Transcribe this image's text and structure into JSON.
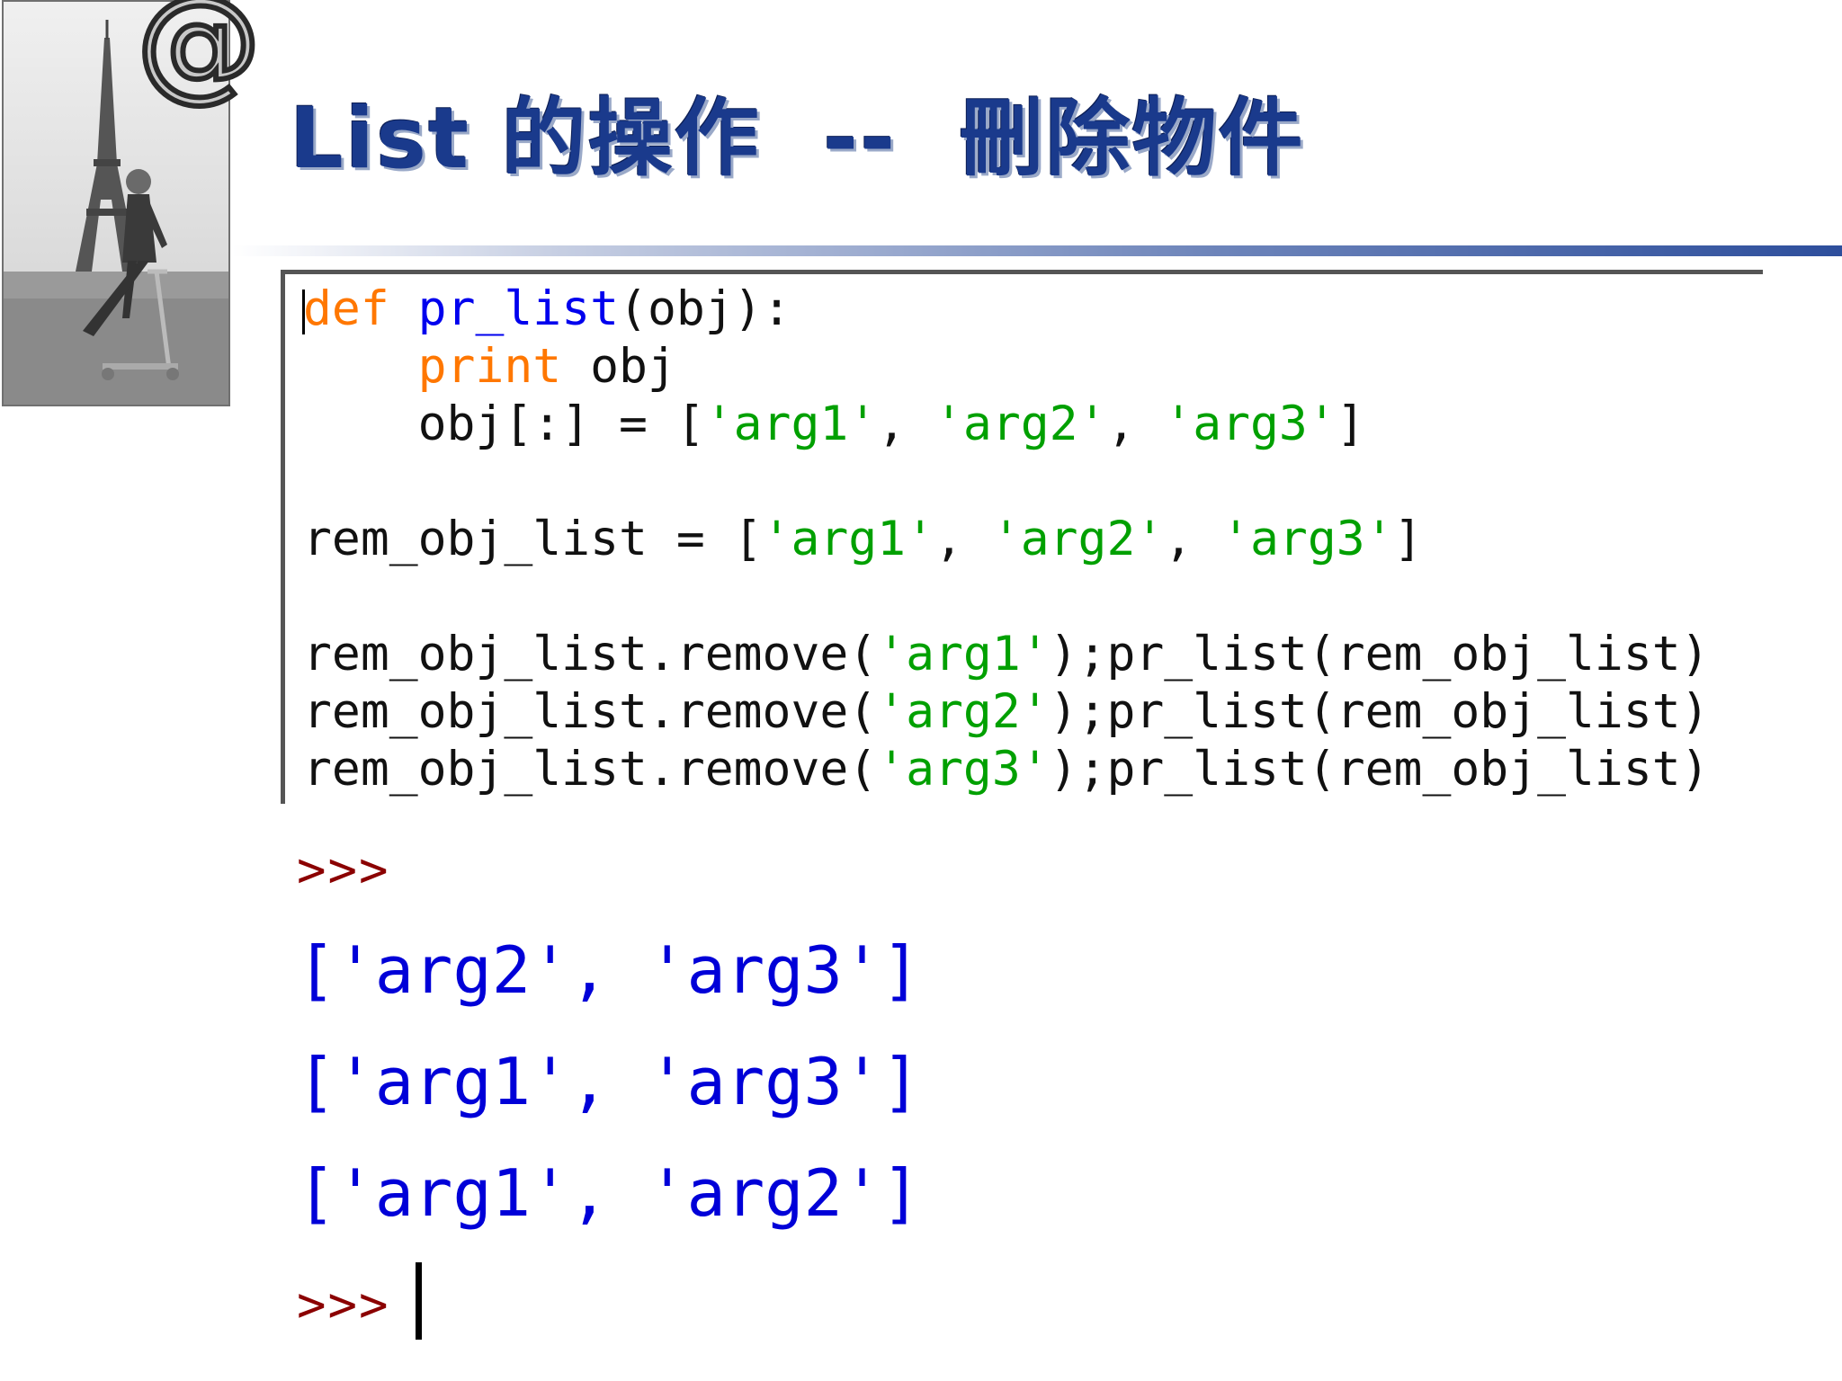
{
  "slide": {
    "title": "List 的操作  --  刪除物件",
    "logo_glyph": "@",
    "photo_icon": "photo-man-on-scooter-eiffel-tower"
  },
  "code": {
    "lines": [
      [
        {
          "t": "def",
          "c": "kw"
        },
        {
          "t": " "
        },
        {
          "t": "pr_list",
          "c": "fn"
        },
        {
          "t": "(obj):"
        }
      ],
      [
        {
          "t": "    "
        },
        {
          "t": "print",
          "c": "kw"
        },
        {
          "t": " obj"
        }
      ],
      [
        {
          "t": "    obj[:] = ["
        },
        {
          "t": "'arg1'",
          "c": "st"
        },
        {
          "t": ", "
        },
        {
          "t": "'arg2'",
          "c": "st"
        },
        {
          "t": ", "
        },
        {
          "t": "'arg3'",
          "c": "st"
        },
        {
          "t": "]"
        }
      ],
      [],
      [
        {
          "t": "rem_obj_list = ["
        },
        {
          "t": "'arg1'",
          "c": "st"
        },
        {
          "t": ", "
        },
        {
          "t": "'arg2'",
          "c": "st"
        },
        {
          "t": ", "
        },
        {
          "t": "'arg3'",
          "c": "st"
        },
        {
          "t": "]"
        }
      ],
      [],
      [
        {
          "t": "rem_obj_list.remove("
        },
        {
          "t": "'arg1'",
          "c": "st"
        },
        {
          "t": ");pr_list(rem_obj_list)"
        }
      ],
      [
        {
          "t": "rem_obj_list.remove("
        },
        {
          "t": "'arg2'",
          "c": "st"
        },
        {
          "t": ");pr_list(rem_obj_list)"
        }
      ],
      [
        {
          "t": "rem_obj_list.remove("
        },
        {
          "t": "'arg3'",
          "c": "st"
        },
        {
          "t": ");pr_list(rem_obj_list)"
        }
      ]
    ]
  },
  "shell": {
    "prompt": ">>>",
    "outputs": [
      "['arg2', 'arg3']",
      "['arg1', 'arg3']",
      "['arg1', 'arg2']"
    ]
  },
  "colors": {
    "keyword": "#ff7700",
    "function_name": "#0000ee",
    "string": "#00a000",
    "prompt": "#8b0000",
    "output": "#0000d8",
    "title": "#1a3a8c"
  }
}
